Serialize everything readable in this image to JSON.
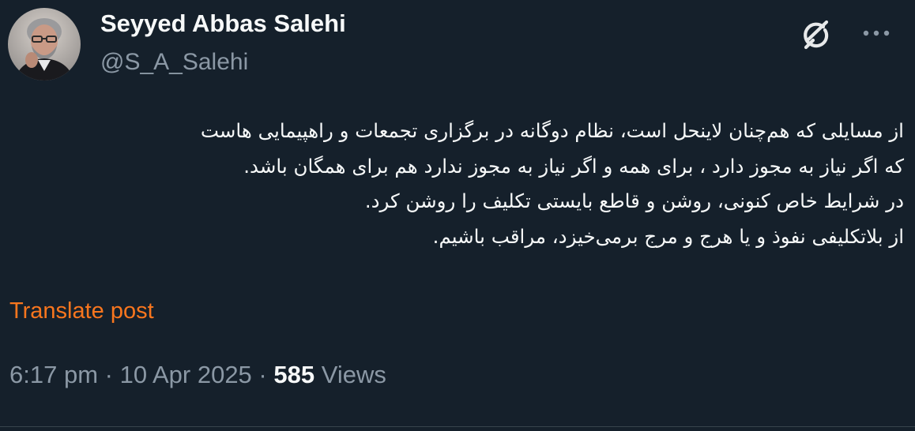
{
  "author": {
    "display_name": "Seyyed Abbas Salehi",
    "handle": "@S_A_Salehi",
    "avatar_icon": "profile-photo"
  },
  "header_actions": {
    "grok_icon": "grok-icon",
    "more_icon": "more-icon"
  },
  "tweet": {
    "lines": [
      "از مسایلی که هم‌چنان لاینحل است، نظام دوگانه در برگزاری تجمعات و راهپیمایی هاست",
      "که اگر نیاز به مجوز دارد ، برای همه و اگر نیاز به مجوز ندارد هم برای همگان باشد.",
      " در شرایط خاص کنونی، روشن و قاطع بایستی تکلیف را روشن کرد.",
      "از بلاتکلیفی نفوذ و یا  هرج و مرج برمی‌خیزد، مراقب باشیم."
    ],
    "translate_label": "Translate post"
  },
  "meta": {
    "time": "6:17 pm",
    "separator": "·",
    "date": "10 Apr 2025",
    "views_count": "585",
    "views_label": "Views"
  },
  "colors": {
    "background": "#15202b",
    "text_primary": "#f7f9f9",
    "text_secondary": "#8b98a5",
    "accent": "#f9761e",
    "divider": "#38444d"
  }
}
